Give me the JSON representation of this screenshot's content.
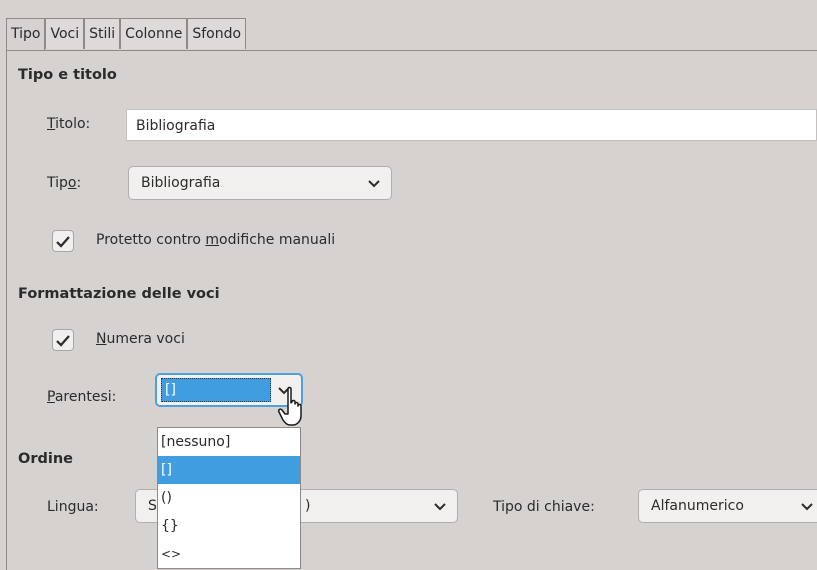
{
  "tabs": [
    "Tipo",
    "Voci",
    "Stili",
    "Colonne",
    "Sfondo"
  ],
  "type_title": {
    "heading": "Tipo e titolo",
    "title_label_first": "T",
    "title_label_rest": "itolo:",
    "title_value": "Bibliografia",
    "type_label_pre": "Tip",
    "type_label_u": "o",
    "type_label_post": ":",
    "type_value": "Bibliografia",
    "protected_pre": "Protetto contro ",
    "protected_u": "m",
    "protected_post": "odifiche manuali",
    "protected_checked": true
  },
  "entries": {
    "heading": "Formattazione delle voci",
    "number_u": "N",
    "number_rest": "umera voci",
    "number_checked": true,
    "brackets_u": "P",
    "brackets_rest": "arentesi:",
    "brackets_value": "[]"
  },
  "brackets_options": [
    "[nessuno]",
    "[]",
    "()",
    "{}",
    "<>"
  ],
  "brackets_selected_index": 1,
  "order": {
    "heading": "Ordine",
    "language_label": "Lingua:",
    "language_value_visible_start": "S",
    "language_value_visible_end": ")",
    "key_type_label": "Tipo di chiave:",
    "key_type_value": "Alfanumerico"
  },
  "colors": {
    "selection": "#3f9de0",
    "focus_border": "#4ea1dd",
    "background": "#d6d2d0"
  }
}
